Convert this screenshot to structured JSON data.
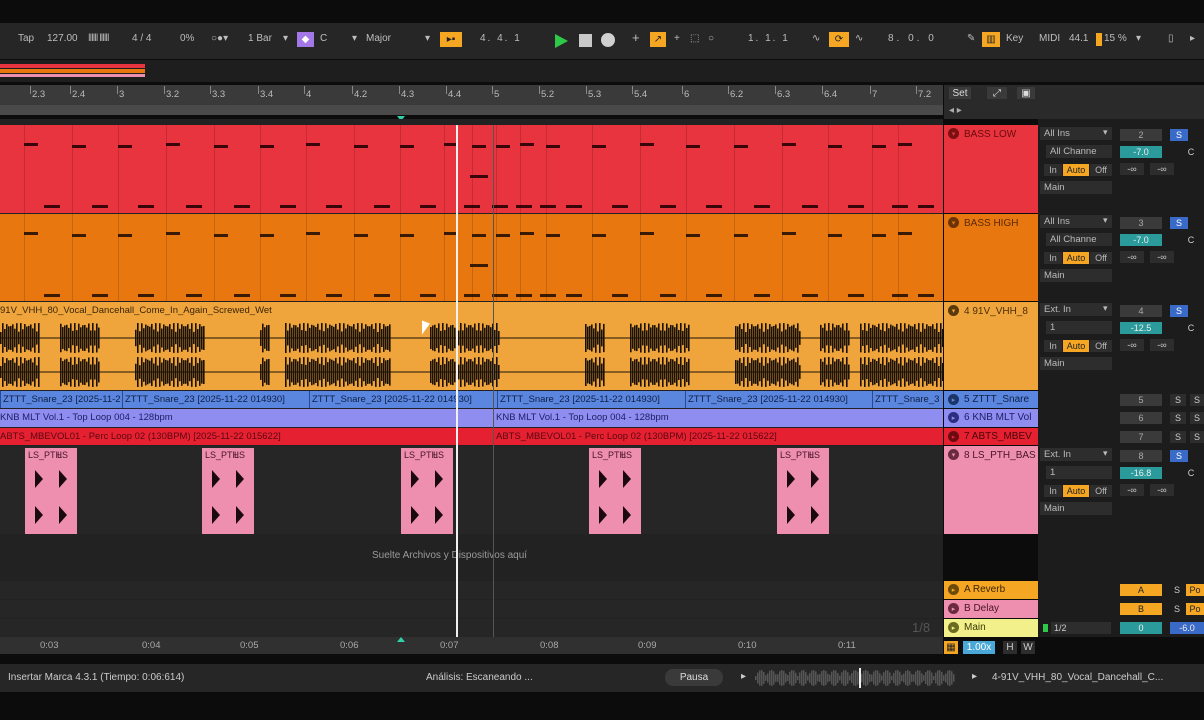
{
  "transport": {
    "tap": "Tap",
    "tempo": "127.00",
    "meter": "4 / 4",
    "swing": "0%",
    "quantize": "1 Bar",
    "key_root": "C",
    "scale": "Major",
    "position": "4. 4. 1",
    "loop_start": "1. 1. 1",
    "loop_length": "8. 0. 0",
    "key_label": "Key",
    "midi_label": "MIDI",
    "sample_rate": "44.1",
    "cpu": "15 %"
  },
  "ruler": {
    "beats": [
      "2.3",
      "2.4",
      "3",
      "3.2",
      "3.3",
      "3.4",
      "4",
      "4.2",
      "4.3",
      "4.4",
      "5",
      "5.2",
      "5.3",
      "5.4",
      "6",
      "6.2",
      "6.3",
      "6.4",
      "7",
      "7.2"
    ],
    "set_label": "Set",
    "times": [
      "0:03",
      "0:04",
      "0:05",
      "0:06",
      "0:07",
      "0:08",
      "0:09",
      "0:10",
      "0:11"
    ]
  },
  "tracks": {
    "bass_low": {
      "name": "BASS LOW",
      "input": "All Ins",
      "channel": "All Channe",
      "in": "In",
      "auto": "Auto",
      "off": "Off",
      "out": "Main",
      "num": "2",
      "solo": "S",
      "vol": "-7.0",
      "pan": "C",
      "send": "-∞"
    },
    "bass_high": {
      "name": "BASS HIGH",
      "input": "All Ins",
      "channel": "All Channe",
      "in": "In",
      "auto": "Auto",
      "off": "Off",
      "out": "Main",
      "num": "3",
      "solo": "S",
      "vol": "-7.0",
      "pan": "C",
      "send": "-∞"
    },
    "vocal": {
      "name": "4 91V_VHH_8",
      "clip": "91V_VHH_80_Vocal_Dancehall_Come_In_Again_Screwed_Wet",
      "input": "Ext. In",
      "channel": "1",
      "in": "In",
      "auto": "Auto",
      "off": "Off",
      "out": "Main",
      "num": "4",
      "solo": "S",
      "vol": "-12.5",
      "pan": "C",
      "send": "-∞"
    },
    "snare": {
      "name": "5 ZTTT_Snare",
      "clips": [
        "ZTTT_Snare_23 [2025-11-2",
        "ZTTT_Snare_23 [2025-11-22 014930]",
        "ZTTT_Snare_23 [2025-11-22 014930]",
        "ZTTT_Snare_23 [2025-11-22 014930]",
        "ZTTT_Snare_23 [2025-11-22 014930]",
        "ZTTT_Snare_3"
      ],
      "num": "5",
      "solo": "S",
      "mute": "S"
    },
    "knb": {
      "name": "6 KNB MLT Vol",
      "clip1": "KNB MLT Vol.1 - Top Loop 004 - 128bpm",
      "clip2": "KNB MLT Vol.1 - Top Loop 004 - 128bpm",
      "num": "6",
      "solo": "S",
      "mute": "S"
    },
    "abts": {
      "name": "7 ABTS_MBEV",
      "clip1": "ABTS_MBEVOL01 - Perc Loop 02 (130BPM) [2025-11-22 015622]",
      "clip2": "ABTS_MBEVOL01 - Perc Loop 02 (130BPM) [2025-11-22 015622]",
      "num": "7",
      "solo": "S",
      "mute": "S"
    },
    "ls_pth": {
      "name": "8 LS_PTH_BAS",
      "clip": "LS_PTH",
      "clip_b": "LS",
      "input": "Ext. In",
      "channel": "1",
      "in": "In",
      "auto": "Auto",
      "off": "Off",
      "out": "Main",
      "num": "8",
      "solo": "S",
      "vol": "-16.8",
      "pan": "C",
      "send": "-∞"
    }
  },
  "drop_hint": "Suelte Archivos y Dispositivos aquí",
  "returns": {
    "reverb": {
      "name": "A Reverb",
      "letter": "A",
      "solo": "S",
      "po": "Po"
    },
    "delay": {
      "name": "B Delay",
      "letter": "B",
      "solo": "S",
      "po": "Po"
    },
    "main": {
      "name": "Main",
      "fraction": "1/2",
      "vol": "0",
      "pan": "-6.0"
    }
  },
  "page_indicator": "1/8",
  "bottom_ctrls": {
    "zoom": "1.00x",
    "h": "H",
    "w": "W"
  },
  "status": {
    "marker": "Insertar Marca 4.3.1 (Tiempo: 0:06:614)",
    "analysis": "Análisis: Escaneando ...",
    "pause": "Pausa",
    "clip_name": "4-91V_VHH_80_Vocal_Dancehall_C..."
  },
  "colors": {
    "bass_low": "#e8343e",
    "bass_high": "#e8770f",
    "vocal": "#f0a53c",
    "snare": "#5a86e0",
    "knb": "#8f8ef0",
    "abts": "#e52131",
    "ls": "#ee8fb0",
    "accent": "#f5a623",
    "play": "#2fc94a"
  }
}
